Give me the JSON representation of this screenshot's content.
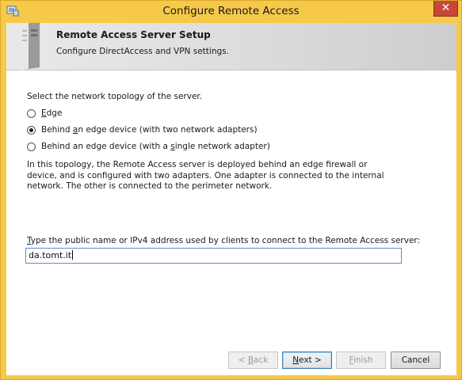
{
  "window": {
    "title": "Configure Remote Access",
    "close_label": "✕"
  },
  "header": {
    "title": "Remote Access Server Setup",
    "subtitle": "Configure DirectAccess and VPN settings."
  },
  "topology": {
    "prompt": "Select the network topology of the server.",
    "options": [
      {
        "pre": "",
        "mnemonic": "E",
        "post": "dge",
        "checked": false
      },
      {
        "pre": "Behind ",
        "mnemonic": "a",
        "post": "n edge device (with two network adapters)",
        "checked": true
      },
      {
        "pre": "Behind an edge device (with a ",
        "mnemonic": "s",
        "post": "ingle network adapter)",
        "checked": false
      }
    ],
    "description": "In this topology, the Remote Access server is deployed behind an edge firewall or device, and is configured with two adapters. One adapter is connected to the internal network. The other is connected to the perimeter network."
  },
  "public_name": {
    "label_mnemonic": "T",
    "label_rest": "ype the public name or IPv4 address used by clients to connect to the Remote Access server:",
    "value": "da.tomt.it"
  },
  "buttons": {
    "back": {
      "pre": "< ",
      "mnemonic": "B",
      "post": "ack"
    },
    "next": {
      "pre": "",
      "mnemonic": "N",
      "post": "ext >"
    },
    "finish": {
      "pre": "",
      "mnemonic": "F",
      "post": "inish"
    },
    "cancel": {
      "label": "Cancel"
    }
  },
  "colors": {
    "frame": "#f6c94a",
    "close": "#c7473a",
    "input_border": "#5b8fd8"
  }
}
